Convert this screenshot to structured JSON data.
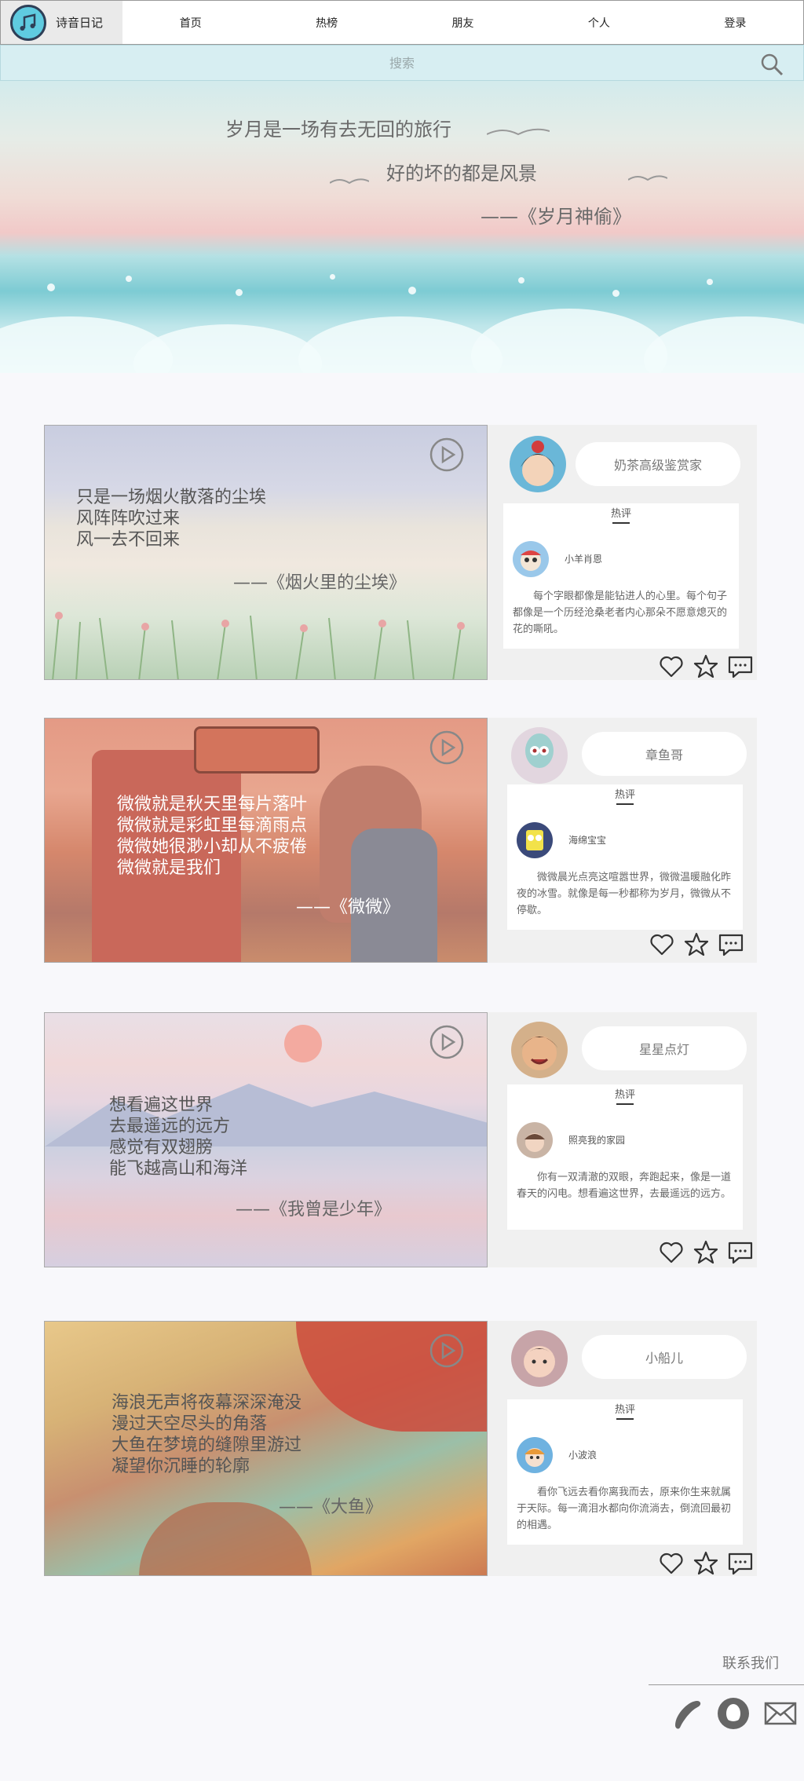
{
  "nav": {
    "logo_text": "诗音日记",
    "items": [
      "首页",
      "热榜",
      "朋友",
      "个人",
      "登录"
    ]
  },
  "search": {
    "placeholder": "搜索"
  },
  "hero": {
    "lines": [
      "岁月是一场有去无回的旅行",
      "好的坏的都是风景",
      "——《岁月神偷》"
    ]
  },
  "posts": [
    {
      "poem": [
        "只是一场烟火散落的尘埃",
        "风阵阵吹过来",
        "风一去不回来"
      ],
      "source": "——《烟火里的尘埃》",
      "user": "奶茶高级鉴赏家",
      "hot_label": "热评",
      "commenter": "小羊肖恩",
      "comment": "每个字眼都像是能钻进人的心里。每个句子都像是一个历经沧桑老者内心那朵不愿意熄灭的花的嘶吼。"
    },
    {
      "poem": [
        "微微就是秋天里每片落叶",
        "微微就是彩虹里每滴雨点",
        "微微她很渺小却从不疲倦",
        "微微就是我们"
      ],
      "source": "——《微微》",
      "user": "章鱼哥",
      "hot_label": "热评",
      "commenter": "海绵宝宝",
      "comment": "微微晨光点亮这喧嚣世界，微微温暖融化昨夜的冰雪。就像是每一秒都称为岁月，微微从不停歇。"
    },
    {
      "poem": [
        "想看遍这世界",
        "去最遥远的远方",
        "感觉有双翅膀",
        "能飞越高山和海洋"
      ],
      "source": "——《我曾是少年》",
      "user": "星星点灯",
      "hot_label": "热评",
      "commenter": "照亮我的家园",
      "comment": "你有一双清澈的双眼，奔跑起来，像是一道春天的闪电。想看遍这世界，去最遥远的远方。"
    },
    {
      "poem": [
        "海浪无声将夜幕深深淹没",
        "漫过天空尽头的角落",
        "大鱼在梦境的缝隙里游过",
        "凝望你沉睡的轮廓"
      ],
      "source": "——《大鱼》",
      "user": "小船儿",
      "hot_label": "热评",
      "commenter": "小波浪",
      "comment": "看你飞远去看你离我而去，原来你生来就属于天际。每一滴泪水都向你流淌去，倒流回最初的相遇。"
    }
  ],
  "footer": {
    "contact": "联系我们"
  },
  "colors": {
    "search_bg": "#d7eef2",
    "card_bg": "#f0f0f0",
    "page_bg": "#f8f8fb"
  }
}
